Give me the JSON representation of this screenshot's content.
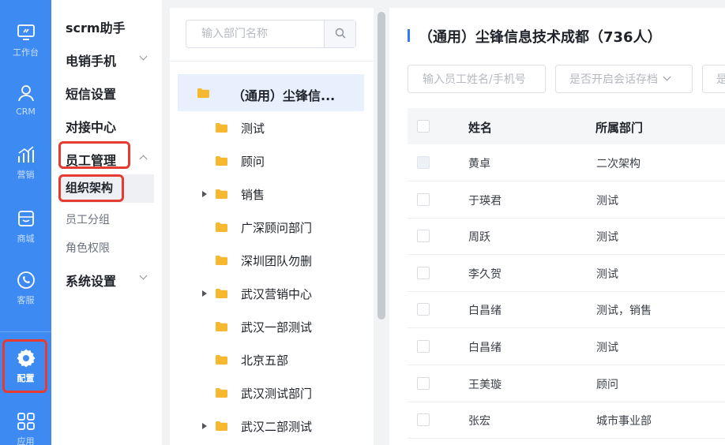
{
  "rail": {
    "items": [
      {
        "label": "工作台",
        "icon": "monitor-icon"
      },
      {
        "label": "CRM",
        "icon": "user-icon"
      },
      {
        "label": "营销",
        "icon": "bar-chart-icon"
      },
      {
        "label": "商城",
        "icon": "store-icon"
      },
      {
        "label": "客服",
        "icon": "phone-bubble-icon"
      },
      {
        "label": "配置",
        "icon": "gear-icon",
        "active": true
      },
      {
        "label": "应用",
        "icon": "grid-icon"
      }
    ]
  },
  "menu": {
    "items": [
      {
        "label": "scrm助手"
      },
      {
        "label": "电销手机",
        "chevron": "down"
      },
      {
        "label": "短信设置"
      },
      {
        "label": "对接中心"
      },
      {
        "label": "员工管理",
        "chevron": "up"
      },
      {
        "label": "组织架构",
        "sub": true,
        "active": true
      },
      {
        "label": "员工分组",
        "sub": true
      },
      {
        "label": "角色权限",
        "sub": true
      },
      {
        "label": "系统设置",
        "chevron": "down"
      }
    ]
  },
  "tree": {
    "search_placeholder": "输入部门名称",
    "root": "（通用）尘锋信...",
    "nodes": [
      {
        "label": "测试",
        "expandable": false
      },
      {
        "label": "顾问",
        "expandable": false
      },
      {
        "label": "销售",
        "expandable": true
      },
      {
        "label": "广深顾问部门",
        "expandable": false
      },
      {
        "label": "深圳团队勿删",
        "expandable": false
      },
      {
        "label": "武汉营销中心",
        "expandable": true
      },
      {
        "label": "武汉一部测试",
        "expandable": false
      },
      {
        "label": "北京五部",
        "expandable": false
      },
      {
        "label": "武汉测试部门",
        "expandable": false
      },
      {
        "label": "武汉二部测试",
        "expandable": true
      }
    ]
  },
  "main": {
    "title": "（通用）尘锋信息技术成都（736人）",
    "filters": {
      "name_placeholder": "输入员工姓名/手机号",
      "session_archive": "是否开启会话存档",
      "third": "是"
    },
    "columns": [
      "姓名",
      "所属部门"
    ],
    "rows": [
      {
        "name": "黄卓",
        "dept": "二次架构"
      },
      {
        "name": "于瑛君",
        "dept": "测试"
      },
      {
        "name": "周跃",
        "dept": "测试"
      },
      {
        "name": "李久贺",
        "dept": "测试"
      },
      {
        "name": "白昌绪",
        "dept": "测试，销售"
      },
      {
        "name": "白昌绪",
        "dept": "测试"
      },
      {
        "name": "王美璇",
        "dept": "顾问"
      },
      {
        "name": "张宏",
        "dept": "城市事业部"
      }
    ]
  },
  "colors": {
    "rail": "#3d8bf2",
    "accent": "#2f7cf6",
    "highlight": "#e53b30",
    "selected_row": "#e8f0fd",
    "folder": "#f5b82e"
  }
}
